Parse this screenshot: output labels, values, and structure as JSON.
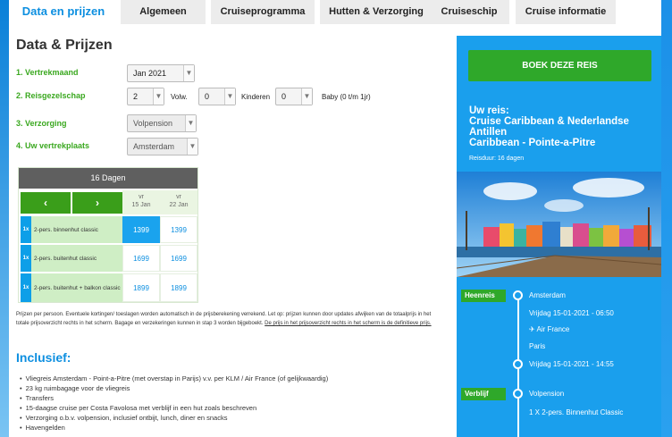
{
  "tabs": [
    "Data en prijzen",
    "Algemeen",
    "Cruiseprogramma",
    "Hutten & Verzorging",
    "Cruiseschip",
    "Cruise informatie"
  ],
  "page_title": "Data & Prijzen",
  "form": {
    "departure_month_label": "1. Vertrekmaand",
    "departure_month_value": "Jan 2021",
    "travel_party_label": "2. Reisgezelschap",
    "adults_value": "2",
    "adults_label": "Volw.",
    "children_value": "0",
    "children_label": "Kinderen",
    "baby_value": "0",
    "baby_label": "Baby (0 t/m 1jr)",
    "board_label": "3. Verzorging",
    "board_value": "Volpension",
    "departure_place_label": "4. Uw vertrekplaats",
    "departure_place_value": "Amsterdam"
  },
  "price_grid": {
    "duration": "16 Dagen",
    "prev_icon": "chevron-left-icon",
    "next_icon": "chevron-right-icon",
    "dates": [
      {
        "day": "vr",
        "date": "15 Jan"
      },
      {
        "day": "vr",
        "date": "22 Jan"
      }
    ],
    "rows": [
      {
        "qty": "1x",
        "label": "2-pers. binnenhut classic",
        "prices": [
          "1399",
          "1399"
        ]
      },
      {
        "qty": "1x",
        "label": "2-pers. buitenhut classic",
        "prices": [
          "1699",
          "1699"
        ]
      },
      {
        "qty": "1x",
        "label": "2-pers. buitenhut + balkon classic",
        "prices": [
          "1899",
          "1899"
        ]
      }
    ]
  },
  "note": {
    "text": "Prijzen per persoon. Eventuele kortingen/ toeslagen worden automatisch in de prijsberekening verrekend. Let op: prijzen kunnen door updates afwijken van de totaalprijs in het totale prijsoverzicht rechts in het scherm. Bagage en verzekeringen kunnen in stap 3 worden bijgeboekt. ",
    "link": "De prijs in het prijsoverzicht rechts in het scherm is de definitieve prijs."
  },
  "inclusief": {
    "heading": "Inclusief:",
    "items": [
      "Vliegreis Amsterdam - Point-a-Pitre (met overstap in Parijs) v.v. per KLM / Air France (of gelijkwaardig)",
      "23 kg ruimbagage voor de vliegreis",
      "Transfers",
      "15-daagse cruise per Costa Favolosa met verblijf in een hut zoals beschreven",
      "Verzorging o.b.v. volpension, inclusief ontbijt, lunch, diner en snacks",
      "Havengelden"
    ]
  },
  "panel": {
    "book_button": "BOEK DEZE REIS",
    "trip_title_1": "Uw reis:",
    "trip_title_2": "Cruise Caribbean & Nederlandse Antillen",
    "trip_title_3": "Caribbean - Pointe-a-Pitre",
    "duration": "Reisduur: 16 dagen",
    "timeline": {
      "outbound_tag": "Heenreis",
      "origin": "Amsterdam",
      "depart_time": "Vrijdag 15-01-2021 - 06:50",
      "airline": "Air France",
      "airline_icon": "airplane-icon",
      "stopover": "Paris",
      "stopover_time": "Vrijdag 15-01-2021 - 14:55",
      "stay_tag": "Verblijf",
      "board": "Volpension",
      "cabin": "1 X 2-pers. Binnenhut Classic"
    }
  },
  "colors": {
    "accent_blue": "#0d8fe0",
    "green": "#3aa81f",
    "panel_blue": "#1a9fed",
    "button_green": "#2fa82a"
  }
}
